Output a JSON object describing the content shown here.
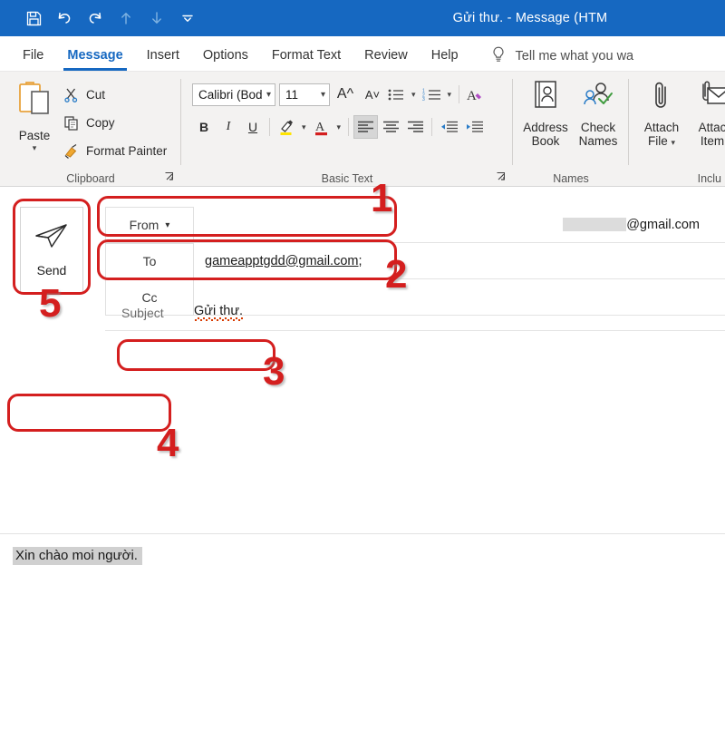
{
  "window": {
    "title": "Gửi thư.  -  Message (HTM",
    "accent_color": "#1668c1",
    "annotation_color": "#d41f1f"
  },
  "quick_access": [
    {
      "name": "save-icon",
      "label": "Save",
      "dim": false
    },
    {
      "name": "undo-icon",
      "label": "Undo",
      "dim": false
    },
    {
      "name": "redo-icon",
      "label": "Redo",
      "dim": false
    },
    {
      "name": "up-arrow-icon",
      "label": "Previous Item",
      "dim": true
    },
    {
      "name": "down-arrow-icon",
      "label": "Next Item",
      "dim": true
    },
    {
      "name": "chevron-down-icon",
      "label": "Customize Quick Access Toolbar",
      "dim": false
    }
  ],
  "tabs": [
    {
      "label": "File",
      "active": false
    },
    {
      "label": "Message",
      "active": true
    },
    {
      "label": "Insert",
      "active": false
    },
    {
      "label": "Options",
      "active": false
    },
    {
      "label": "Format Text",
      "active": false
    },
    {
      "label": "Review",
      "active": false
    },
    {
      "label": "Help",
      "active": false
    }
  ],
  "tell_me": {
    "icon": "lightbulb-icon",
    "placeholder": "Tell me what you wa"
  },
  "ribbon": {
    "groups": [
      {
        "label": "Clipboard"
      },
      {
        "label": "Basic Text"
      },
      {
        "label": "Names"
      },
      {
        "label": "Inclu"
      }
    ],
    "clipboard": {
      "paste_label": "Paste",
      "items": [
        {
          "label": "Cut",
          "icon": "scissors-icon"
        },
        {
          "label": "Copy",
          "icon": "copy-icon"
        },
        {
          "label": "Format Painter",
          "icon": "paintbrush-icon"
        }
      ]
    },
    "basic_text": {
      "font_name": "Calibri (Bod",
      "font_size": "11",
      "grow_font": "A",
      "shrink_font": "A",
      "bold": "B",
      "italic": "I",
      "underline": "U",
      "text_highlight_color": "#ffe400",
      "font_color": "#d41f1f",
      "align_left_active": true
    },
    "names": [
      {
        "line1": "Address",
        "line2": "Book",
        "icon": "address-book-icon"
      },
      {
        "line1": "Check",
        "line2": "Names",
        "icon": "check-names-icon"
      }
    ],
    "include": [
      {
        "line1": "Attach",
        "line2": "File",
        "icon": "paperclip-icon",
        "has_chevron": true
      },
      {
        "line1": "Attac",
        "line2": "Item",
        "icon": "attach-item-icon",
        "has_chevron": false
      }
    ]
  },
  "compose": {
    "send_label": "Send",
    "send_icon": "paper-plane-icon",
    "fields": {
      "from_label": "From",
      "from_value": "@gmail.com",
      "to_label": "To",
      "to_value": "gameapptgdd@gmail.com;",
      "cc_label": "Cc",
      "cc_value": "",
      "subject_label": "Subject",
      "subject_value": "Gửi thư."
    },
    "body_text": "Xin chào moi người."
  },
  "annotations": [
    {
      "number": "1",
      "target": "from-field"
    },
    {
      "number": "2",
      "target": "to-field"
    },
    {
      "number": "3",
      "target": "subject-field"
    },
    {
      "number": "4",
      "target": "message-body"
    },
    {
      "number": "5",
      "target": "send-button"
    }
  ]
}
